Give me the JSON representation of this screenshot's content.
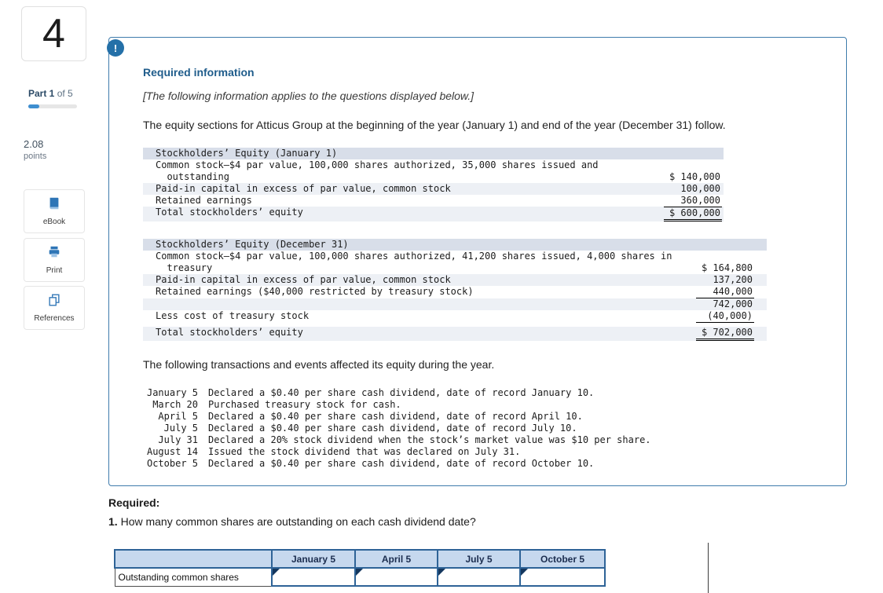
{
  "question": {
    "number": "4",
    "part": "Part 1",
    "part_suffix": " of 5",
    "points_value": "2.08",
    "points_label": "points"
  },
  "tools": {
    "ebook": "eBook",
    "print": "Print",
    "references": "References"
  },
  "info_box": {
    "alert_glyph": "!",
    "heading": "Required information",
    "note": "[The following information applies to the questions displayed below.]",
    "intro": "The equity sections for Atticus Group at the beginning of the year (January 1) and end of the year (December 31) follow.",
    "jan_table": {
      "title": "Stockholders’ Equity (January 1)",
      "rows": [
        {
          "label": "Common stock—$4 par value, 100,000 shares authorized, 35,000 shares issued and\n  outstanding",
          "value": "$ 140,000"
        },
        {
          "label": "Paid-in capital in excess of par value, common stock",
          "value": "100,000"
        },
        {
          "label": "Retained earnings",
          "value": "360,000"
        },
        {
          "label": "Total stockholders’ equity",
          "value": "$ 600,000"
        }
      ]
    },
    "dec_table": {
      "title": "Stockholders’ Equity (December 31)",
      "rows": [
        {
          "label": "Common stock—$4 par value, 100,000 shares authorized, 41,200 shares issued, 4,000 shares in\n  treasury",
          "value": "$ 164,800"
        },
        {
          "label": "Paid-in capital in excess of par value, common stock",
          "value": "137,200"
        },
        {
          "label": "Retained earnings ($40,000 restricted by treasury stock)",
          "value": "440,000"
        },
        {
          "label": "",
          "value": "742,000"
        },
        {
          "label": "Less cost of treasury stock",
          "value": "(40,000)"
        },
        {
          "label": "Total stockholders’ equity",
          "value": "$ 702,000"
        }
      ]
    },
    "transactions_intro": "The following transactions and events affected its equity during the year.",
    "transactions": [
      {
        "date": "January 5",
        "desc": "Declared a $0.40 per share cash dividend, date of record January 10."
      },
      {
        "date": "March 20",
        "desc": "Purchased treasury stock for cash."
      },
      {
        "date": "April 5",
        "desc": "Declared a $0.40 per share cash dividend, date of record April 10."
      },
      {
        "date": "July 5",
        "desc": "Declared a $0.40 per share cash dividend, date of record July 10."
      },
      {
        "date": "July 31",
        "desc": "Declared a 20% stock dividend when the stock’s market value was $10 per share."
      },
      {
        "date": "August 14",
        "desc": "Issued the stock dividend that was declared on July 31."
      },
      {
        "date": "October 5",
        "desc": "Declared a $0.40 per share cash dividend, date of record October 10."
      }
    ]
  },
  "required": {
    "label": "Required:",
    "q_number": "1.",
    "q_text": " How many common shares are outstanding on each cash dividend date?"
  },
  "answer_table": {
    "headers": [
      "",
      "January 5",
      "April 5",
      "July 5",
      "October 5"
    ],
    "row_label": "Outstanding common shares"
  },
  "colors": {
    "accent_blue": "#2e6397",
    "heading_blue": "#1f5c8b",
    "alert_blue": "#2470a8"
  }
}
